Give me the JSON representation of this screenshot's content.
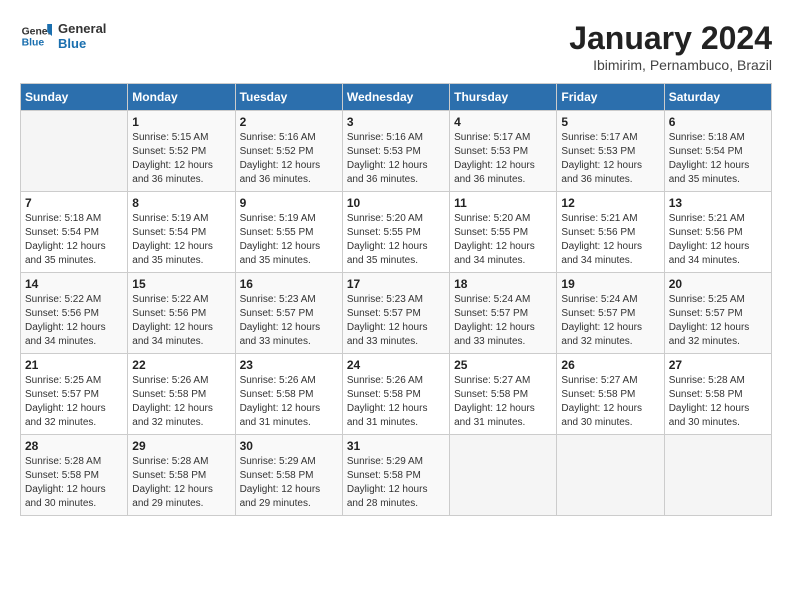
{
  "header": {
    "logo_general": "General",
    "logo_blue": "Blue",
    "month_year": "January 2024",
    "location": "Ibimirim, Pernambuco, Brazil"
  },
  "weekdays": [
    "Sunday",
    "Monday",
    "Tuesday",
    "Wednesday",
    "Thursday",
    "Friday",
    "Saturday"
  ],
  "weeks": [
    [
      {
        "day": "",
        "info": ""
      },
      {
        "day": "1",
        "info": "Sunrise: 5:15 AM\nSunset: 5:52 PM\nDaylight: 12 hours\nand 36 minutes."
      },
      {
        "day": "2",
        "info": "Sunrise: 5:16 AM\nSunset: 5:52 PM\nDaylight: 12 hours\nand 36 minutes."
      },
      {
        "day": "3",
        "info": "Sunrise: 5:16 AM\nSunset: 5:53 PM\nDaylight: 12 hours\nand 36 minutes."
      },
      {
        "day": "4",
        "info": "Sunrise: 5:17 AM\nSunset: 5:53 PM\nDaylight: 12 hours\nand 36 minutes."
      },
      {
        "day": "5",
        "info": "Sunrise: 5:17 AM\nSunset: 5:53 PM\nDaylight: 12 hours\nand 36 minutes."
      },
      {
        "day": "6",
        "info": "Sunrise: 5:18 AM\nSunset: 5:54 PM\nDaylight: 12 hours\nand 35 minutes."
      }
    ],
    [
      {
        "day": "7",
        "info": "Sunrise: 5:18 AM\nSunset: 5:54 PM\nDaylight: 12 hours\nand 35 minutes."
      },
      {
        "day": "8",
        "info": "Sunrise: 5:19 AM\nSunset: 5:54 PM\nDaylight: 12 hours\nand 35 minutes."
      },
      {
        "day": "9",
        "info": "Sunrise: 5:19 AM\nSunset: 5:55 PM\nDaylight: 12 hours\nand 35 minutes."
      },
      {
        "day": "10",
        "info": "Sunrise: 5:20 AM\nSunset: 5:55 PM\nDaylight: 12 hours\nand 35 minutes."
      },
      {
        "day": "11",
        "info": "Sunrise: 5:20 AM\nSunset: 5:55 PM\nDaylight: 12 hours\nand 34 minutes."
      },
      {
        "day": "12",
        "info": "Sunrise: 5:21 AM\nSunset: 5:56 PM\nDaylight: 12 hours\nand 34 minutes."
      },
      {
        "day": "13",
        "info": "Sunrise: 5:21 AM\nSunset: 5:56 PM\nDaylight: 12 hours\nand 34 minutes."
      }
    ],
    [
      {
        "day": "14",
        "info": "Sunrise: 5:22 AM\nSunset: 5:56 PM\nDaylight: 12 hours\nand 34 minutes."
      },
      {
        "day": "15",
        "info": "Sunrise: 5:22 AM\nSunset: 5:56 PM\nDaylight: 12 hours\nand 34 minutes."
      },
      {
        "day": "16",
        "info": "Sunrise: 5:23 AM\nSunset: 5:57 PM\nDaylight: 12 hours\nand 33 minutes."
      },
      {
        "day": "17",
        "info": "Sunrise: 5:23 AM\nSunset: 5:57 PM\nDaylight: 12 hours\nand 33 minutes."
      },
      {
        "day": "18",
        "info": "Sunrise: 5:24 AM\nSunset: 5:57 PM\nDaylight: 12 hours\nand 33 minutes."
      },
      {
        "day": "19",
        "info": "Sunrise: 5:24 AM\nSunset: 5:57 PM\nDaylight: 12 hours\nand 32 minutes."
      },
      {
        "day": "20",
        "info": "Sunrise: 5:25 AM\nSunset: 5:57 PM\nDaylight: 12 hours\nand 32 minutes."
      }
    ],
    [
      {
        "day": "21",
        "info": "Sunrise: 5:25 AM\nSunset: 5:57 PM\nDaylight: 12 hours\nand 32 minutes."
      },
      {
        "day": "22",
        "info": "Sunrise: 5:26 AM\nSunset: 5:58 PM\nDaylight: 12 hours\nand 32 minutes."
      },
      {
        "day": "23",
        "info": "Sunrise: 5:26 AM\nSunset: 5:58 PM\nDaylight: 12 hours\nand 31 minutes."
      },
      {
        "day": "24",
        "info": "Sunrise: 5:26 AM\nSunset: 5:58 PM\nDaylight: 12 hours\nand 31 minutes."
      },
      {
        "day": "25",
        "info": "Sunrise: 5:27 AM\nSunset: 5:58 PM\nDaylight: 12 hours\nand 31 minutes."
      },
      {
        "day": "26",
        "info": "Sunrise: 5:27 AM\nSunset: 5:58 PM\nDaylight: 12 hours\nand 30 minutes."
      },
      {
        "day": "27",
        "info": "Sunrise: 5:28 AM\nSunset: 5:58 PM\nDaylight: 12 hours\nand 30 minutes."
      }
    ],
    [
      {
        "day": "28",
        "info": "Sunrise: 5:28 AM\nSunset: 5:58 PM\nDaylight: 12 hours\nand 30 minutes."
      },
      {
        "day": "29",
        "info": "Sunrise: 5:28 AM\nSunset: 5:58 PM\nDaylight: 12 hours\nand 29 minutes."
      },
      {
        "day": "30",
        "info": "Sunrise: 5:29 AM\nSunset: 5:58 PM\nDaylight: 12 hours\nand 29 minutes."
      },
      {
        "day": "31",
        "info": "Sunrise: 5:29 AM\nSunset: 5:58 PM\nDaylight: 12 hours\nand 28 minutes."
      },
      {
        "day": "",
        "info": ""
      },
      {
        "day": "",
        "info": ""
      },
      {
        "day": "",
        "info": ""
      }
    ]
  ]
}
